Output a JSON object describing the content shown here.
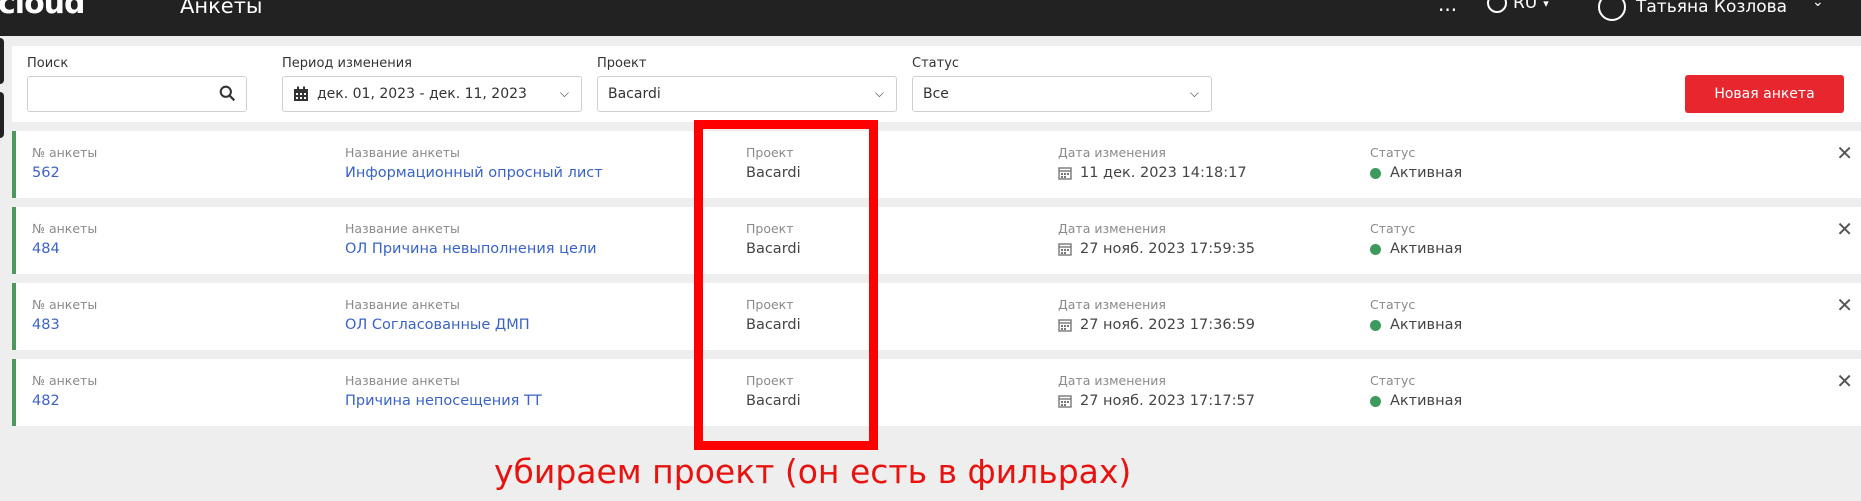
{
  "topbar": {
    "logo": "cloud",
    "title": "Анкеты",
    "more": "...",
    "language": "RU",
    "user_name": "Татьяна Козлова"
  },
  "filters": {
    "search_label": "Поиск",
    "search_value": "",
    "period_label": "Период изменения",
    "period_value": "дек. 01, 2023 - дек. 11, 2023",
    "project_label": "Проект",
    "project_value": "Bacardi",
    "status_label": "Статус",
    "status_value": "Все",
    "new_button": "Новая анкета"
  },
  "columns": {
    "number": "№ анкеты",
    "name": "Название анкеты",
    "project": "Проект",
    "date": "Дата изменения",
    "status": "Статус"
  },
  "rows": [
    {
      "number": "562",
      "name": "Информационный опросный лист",
      "project": "Bacardi",
      "date": "11 дек. 2023 14:18:17",
      "status": "Активная"
    },
    {
      "number": "484",
      "name": "ОЛ Причина невыполнения цели",
      "project": "Bacardi",
      "date": "27 нояб. 2023 17:59:35",
      "status": "Активная"
    },
    {
      "number": "483",
      "name": "ОЛ Согласованные ДМП",
      "project": "Bacardi",
      "date": "27 нояб. 2023 17:36:59",
      "status": "Активная"
    },
    {
      "number": "482",
      "name": "Причина непосещения ТТ",
      "project": "Bacardi",
      "date": "27 нояб. 2023 17:17:57",
      "status": "Активная"
    }
  ],
  "annotation": {
    "text": "убираем проект (он есть в фильрах)",
    "color": "#ff0000"
  },
  "colors": {
    "accent_red": "#e8262e",
    "link_blue": "#3a63c8",
    "status_green": "#3d9a5d",
    "topbar": "#222222"
  }
}
